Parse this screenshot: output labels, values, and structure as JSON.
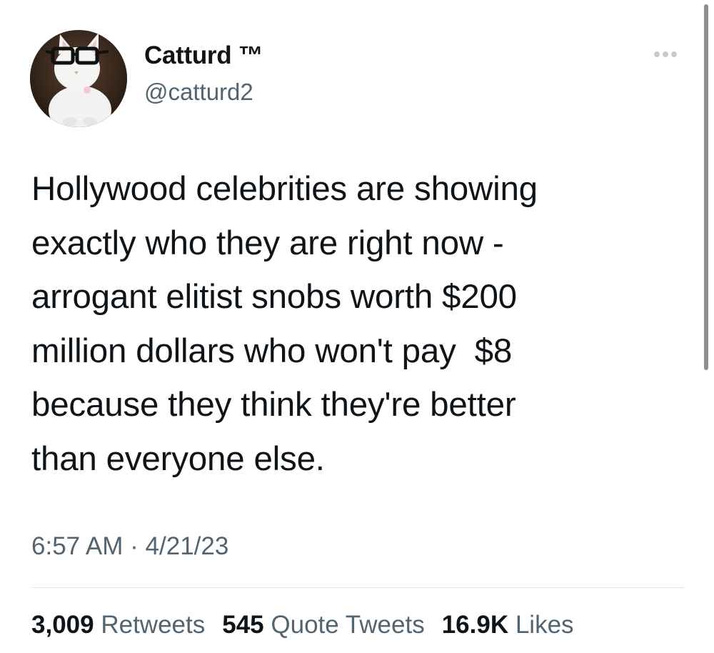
{
  "author": {
    "display_name": "Catturd ™",
    "handle": "@catturd2"
  },
  "tweet": {
    "text": "Hollywood celebrities are showing\nexactly who they are right now -\narrogant elitist snobs worth $200\nmillion dollars who won't pay  $8\nbecause they think they're better\nthan everyone else.",
    "time": "6:57 AM",
    "separator": "·",
    "date": "4/21/23"
  },
  "stats": {
    "retweets_count": "3,009",
    "retweets_label": "Retweets",
    "quotes_count": "545",
    "quotes_label": "Quote Tweets",
    "likes_count": "16.9K",
    "likes_label": "Likes"
  },
  "icons": {
    "more": "more-horizontal-icon"
  },
  "colors": {
    "text_primary": "#0f1419",
    "text_secondary": "#536471",
    "divider": "#dfe3e6"
  }
}
